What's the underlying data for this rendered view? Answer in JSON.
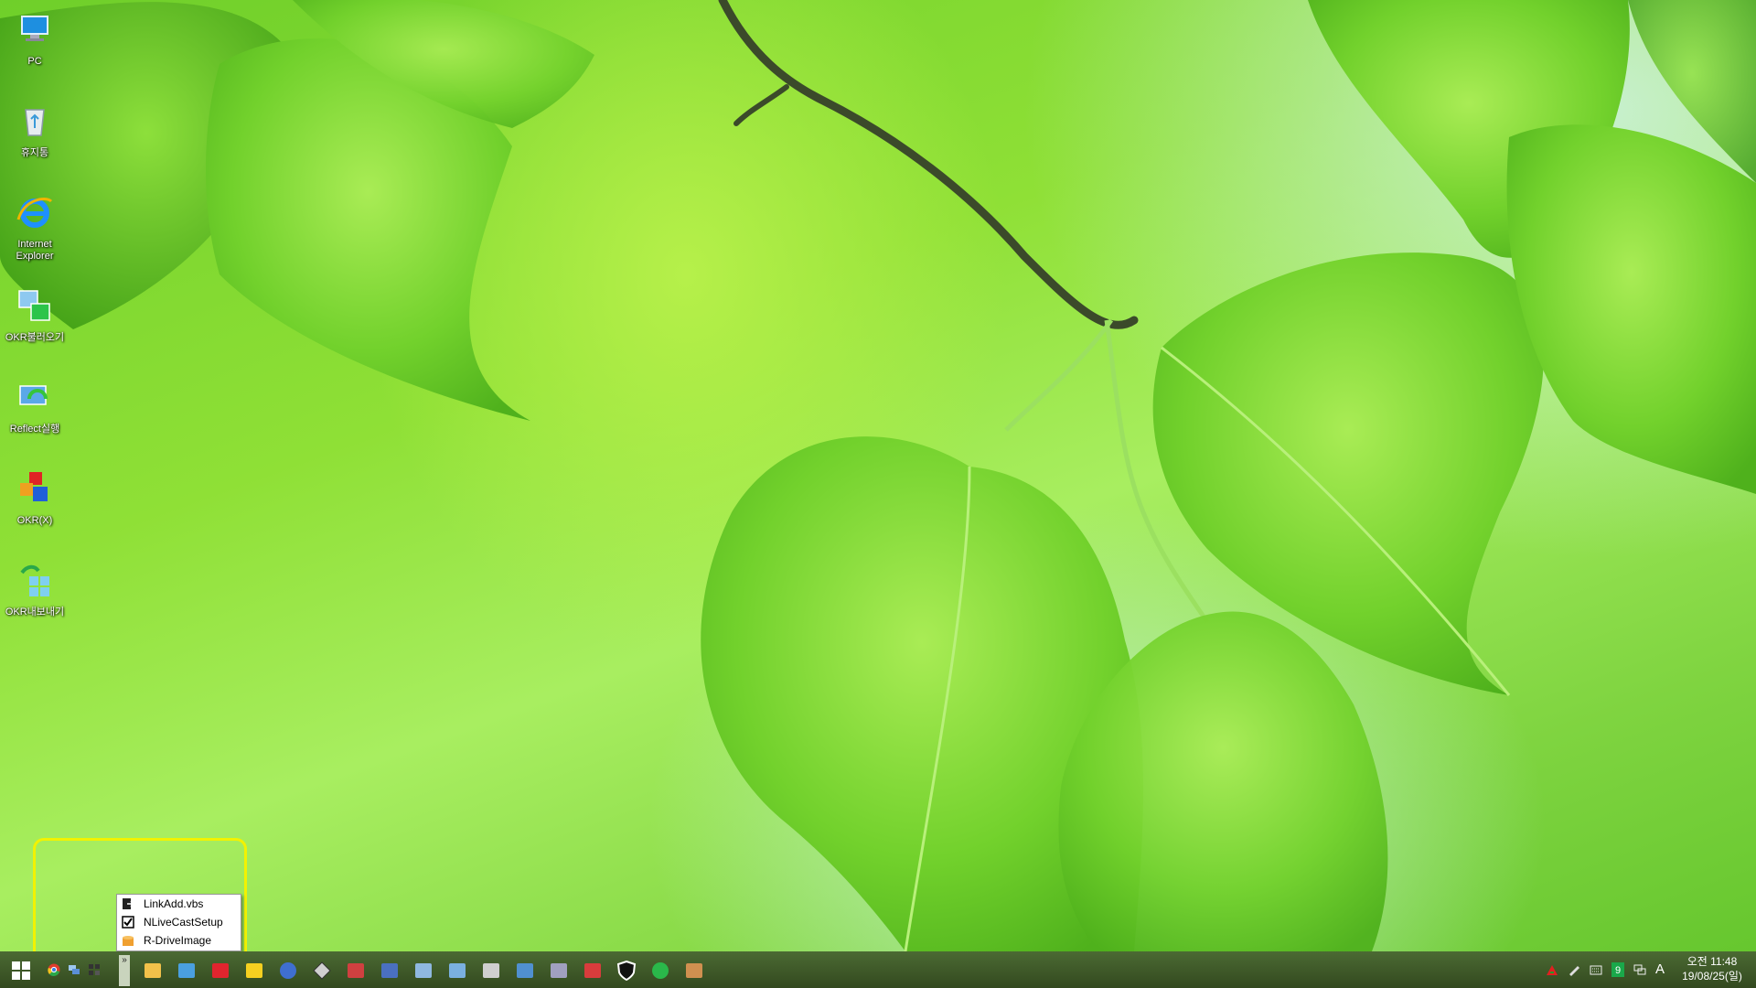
{
  "desktop": {
    "icons": [
      {
        "label": "PC",
        "icon": "pc-icon"
      },
      {
        "label": "휴지통",
        "icon": "recycle-bin-icon"
      },
      {
        "label": "Internet Explorer",
        "icon": "internet-explorer-icon"
      },
      {
        "label": "OKR불러오기",
        "icon": "okr-import-icon"
      },
      {
        "label": "Reflect실행",
        "icon": "reflect-icon"
      },
      {
        "label": "OKR(X)",
        "icon": "okr-x-icon"
      },
      {
        "label": "OKR내보내기",
        "icon": "okr-export-icon"
      }
    ]
  },
  "popup": {
    "items": [
      {
        "label": "LinkAdd.vbs",
        "icon": "script-icon"
      },
      {
        "label": "NLiveCastSetup",
        "icon": "checkbox-icon"
      },
      {
        "label": "R-DriveImage",
        "icon": "drive-image-icon"
      }
    ]
  },
  "taskbar": {
    "start_icon": "windows-start-icon",
    "toolbar_overflow": "»",
    "pinned": [
      "chrome-icon",
      "network-icon",
      "tiles-icon",
      "file-explorer-icon",
      "remote-desktop-icon",
      "anydesk-icon",
      "potplayer-icon",
      "blue-orb-icon",
      "disk-tool-icon",
      "colors-icon",
      "user-icon",
      "bottle-icon",
      "windows-setup-icon",
      "tools-icon",
      "laptop-icon",
      "settings-panel-icon",
      "calendar-icon",
      "shield-icon",
      "sync-icon",
      "archive-icon"
    ],
    "tray": {
      "icons": [
        "red-a-icon",
        "pen-icon",
        "keyboard-icon",
        "green-9-icon",
        "network-status-icon"
      ],
      "ime": "A",
      "time": "오전 11:48",
      "date": "19/08/25(일)"
    }
  },
  "colors": {
    "highlight": "#f2f200",
    "taskbar": "#3f5b2a"
  }
}
